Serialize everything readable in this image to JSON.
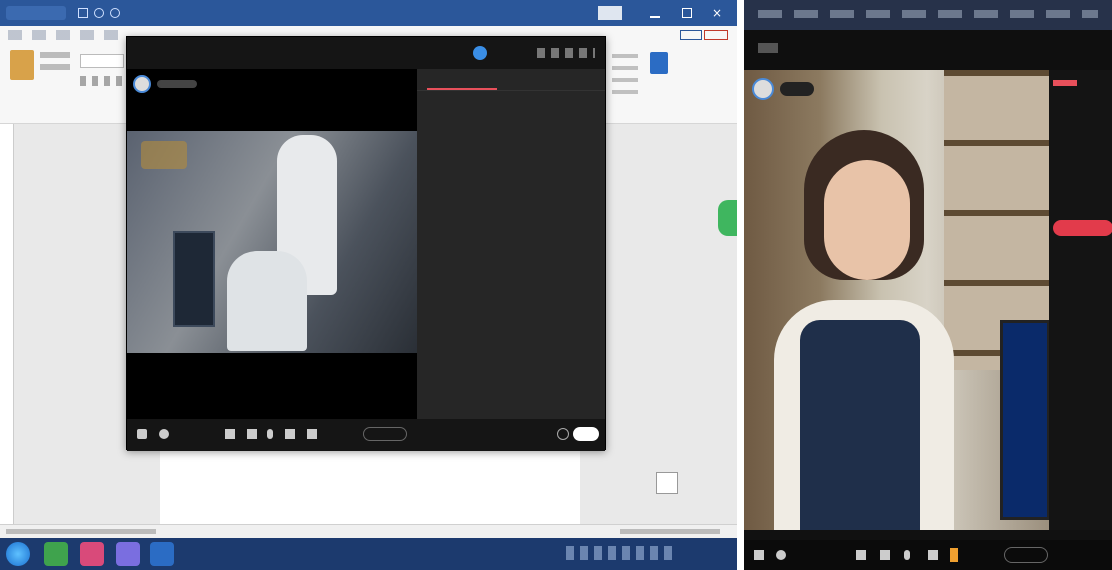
{
  "left": {
    "word_title": "",
    "live_window": {
      "title": "",
      "chat_tabs": [
        "",
        ""
      ],
      "chat_lines": [
        "",
        "",
        "",
        "",
        "",
        "",
        "",
        "",
        "",
        "",
        "",
        "",
        "",
        "",
        ""
      ],
      "controls": {
        "share": "",
        "end": ""
      }
    }
  },
  "right": {
    "title": "",
    "side_label": "",
    "controls": {
      "end": ""
    }
  }
}
